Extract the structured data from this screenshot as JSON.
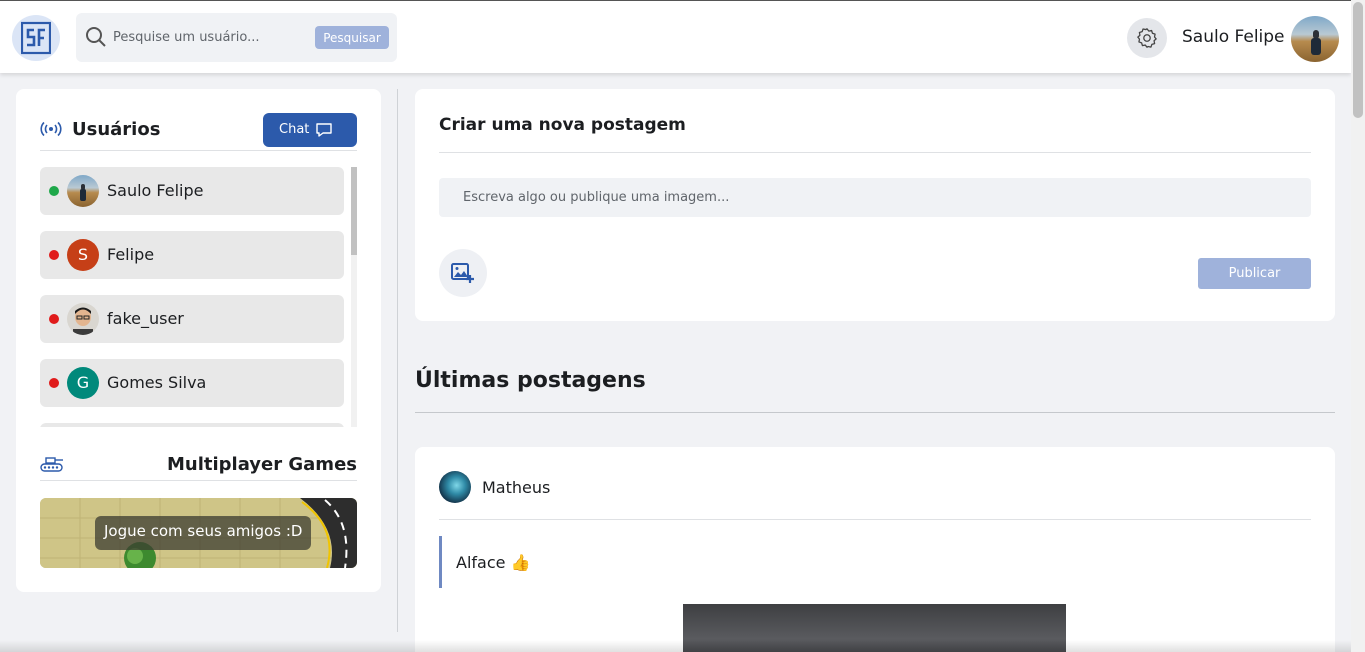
{
  "header": {
    "logo_text": "S",
    "search_placeholder": "Pesquise um usuário...",
    "search_button": "Pesquisar",
    "user_name": "Saulo Felipe"
  },
  "sidebar": {
    "title": "Usuários",
    "chat_button": "Chat",
    "users": [
      {
        "name": "Saulo Felipe",
        "status": "online",
        "status_color": "#1fa84a",
        "avatar": "photo",
        "avatar_letter": ""
      },
      {
        "name": "Felipe",
        "status": "offline",
        "status_color": "#e01b1b",
        "avatar": "letter",
        "avatar_letter": "S",
        "avatar_color": "#c63f17"
      },
      {
        "name": "fake_user",
        "status": "offline",
        "status_color": "#e01b1b",
        "avatar": "photo",
        "avatar_letter": ""
      },
      {
        "name": "Gomes Silva",
        "status": "offline",
        "status_color": "#e01b1b",
        "avatar": "letter",
        "avatar_letter": "G",
        "avatar_color": "#00897b"
      }
    ],
    "games_title": "Multiplayer Games",
    "games_banner_text": "Jogue com seus amigos :D"
  },
  "create_post": {
    "title": "Criar uma nova postagem",
    "input_placeholder": "Escreva algo ou publique uma imagem...",
    "publish_button": "Publicar"
  },
  "feed": {
    "title": "Últimas postagens",
    "posts": [
      {
        "author": "Matheus",
        "text": "Alface 👍"
      }
    ]
  },
  "colors": {
    "accent": "#2c5aab",
    "accent_disabled": "#9fb2db",
    "online": "#1fa84a",
    "offline": "#e01b1b"
  }
}
